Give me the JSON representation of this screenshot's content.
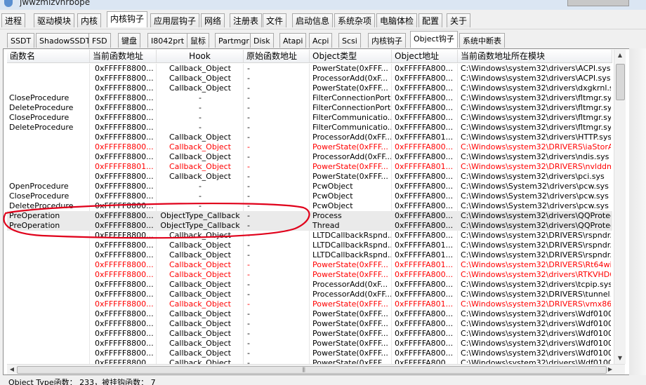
{
  "window": {
    "title": "jwwzmizvnrbope"
  },
  "menu_tabs": [
    "进程",
    "驱动模块",
    "内核",
    "内核钩子",
    "应用层钩子",
    "网络",
    "注册表",
    "文件",
    "启动信息",
    "系统杂项",
    "电脑体检",
    "配置",
    "关于"
  ],
  "sub_tabs": [
    "SSDT",
    "ShadowSSDT",
    "FSD",
    "键盘",
    "I8042prt",
    "鼠标",
    "Partmgr",
    "Disk",
    "Atapi",
    "Acpi",
    "Scsi",
    "内核钩子",
    "Object钩子",
    "系统中断表"
  ],
  "columns": [
    "函数名",
    "当前函数地址",
    "Hook",
    "原始函数地址",
    "Object类型",
    "Object地址",
    "当前函数地址所在模块"
  ],
  "rows": [
    {
      "name": "",
      "addr": "0xFFFFF8800...",
      "hook": "Callback_Object",
      "orig": "-",
      "type": "PowerState(0xFFF...",
      "oaddr": "0xFFFFFA800...",
      "module": "C:\\Windows\\system32\\drivers\\ACPI.sys",
      "red": false
    },
    {
      "name": "",
      "addr": "0xFFFFF8800...",
      "hook": "Callback_Object",
      "orig": "-",
      "type": "ProcessorAdd(0xF...",
      "oaddr": "0xFFFFFA800...",
      "module": "C:\\Windows\\system32\\drivers\\ACPI.sys",
      "red": false
    },
    {
      "name": "",
      "addr": "0xFFFFF8800...",
      "hook": "Callback_Object",
      "orig": "-",
      "type": "PowerState(0xFFF...",
      "oaddr": "0xFFFFFA800...",
      "module": "C:\\Windows\\system32\\drivers\\dxgkrnl.sys",
      "red": false
    },
    {
      "name": "CloseProcedure",
      "addr": "0xFFFFF8800...",
      "hook": "-",
      "orig": "-",
      "type": "FilterConnectionPort",
      "oaddr": "0xFFFFFA800...",
      "module": "C:\\Windows\\system32\\drivers\\fltmgr.sys",
      "red": false
    },
    {
      "name": "DeleteProcedure",
      "addr": "0xFFFFF8800...",
      "hook": "-",
      "orig": "-",
      "type": "FilterConnectionPort",
      "oaddr": "0xFFFFFA800...",
      "module": "C:\\Windows\\system32\\drivers\\fltmgr.sys",
      "red": false
    },
    {
      "name": "CloseProcedure",
      "addr": "0xFFFFF8800...",
      "hook": "-",
      "orig": "-",
      "type": "FilterCommunicatio...",
      "oaddr": "0xFFFFFA800...",
      "module": "C:\\Windows\\system32\\drivers\\fltmgr.sys",
      "red": false
    },
    {
      "name": "DeleteProcedure",
      "addr": "0xFFFFF8800...",
      "hook": "-",
      "orig": "-",
      "type": "FilterCommunicatio...",
      "oaddr": "0xFFFFFA800...",
      "module": "C:\\Windows\\system32\\drivers\\fltmgr.sys",
      "red": false
    },
    {
      "name": "",
      "addr": "0xFFFFF8800...",
      "hook": "Callback_Object",
      "orig": "-",
      "type": "ProcessorAdd(0xFF...",
      "oaddr": "0xFFFFFA801...",
      "module": "C:\\Windows\\system32\\drivers\\HTTP.sys",
      "red": false
    },
    {
      "name": "",
      "addr": "0xFFFFF8800...",
      "hook": "Callback_Object",
      "orig": "-",
      "type": "PowerState(0xFFF...",
      "oaddr": "0xFFFFFA800...",
      "module": "C:\\Windows\\system32\\DRIVERS\\iaStorA.sys",
      "red": true
    },
    {
      "name": "",
      "addr": "0xFFFFF8800...",
      "hook": "Callback_Object",
      "orig": "-",
      "type": "ProcessorAdd(0xFF...",
      "oaddr": "0xFFFFFA800...",
      "module": "C:\\Windows\\system32\\drivers\\ndis.sys",
      "red": false
    },
    {
      "name": "",
      "addr": "0xFFFFF8801...",
      "hook": "Callback_Object",
      "orig": "-",
      "type": "PowerState(0xFFF...",
      "oaddr": "0xFFFFFA801...",
      "module": "C:\\Windows\\system32\\DRIVERS\\nvlddmkm...",
      "red": true
    },
    {
      "name": "",
      "addr": "0xFFFFF8800...",
      "hook": "Callback_Object",
      "orig": "-",
      "type": "PowerState(0xFFF...",
      "oaddr": "0xFFFFFA800...",
      "module": "C:\\Windows\\system32\\drivers\\pci.sys",
      "red": false
    },
    {
      "name": "OpenProcedure",
      "addr": "0xFFFFF8800...",
      "hook": "-",
      "orig": "-",
      "type": "PcwObject",
      "oaddr": "0xFFFFFA800...",
      "module": "C:\\Windows\\System32\\drivers\\pcw.sys",
      "red": false
    },
    {
      "name": "CloseProcedure",
      "addr": "0xFFFFF8800...",
      "hook": "-",
      "orig": "-",
      "type": "PcwObject",
      "oaddr": "0xFFFFFA800...",
      "module": "C:\\Windows\\System32\\drivers\\pcw.sys",
      "red": false
    },
    {
      "name": "DeleteProcedure",
      "addr": "0xFFFFF8800...",
      "hook": "-",
      "orig": "-",
      "type": "PcwObject",
      "oaddr": "0xFFFFFA800...",
      "module": "C:\\Windows\\System32\\drivers\\pcw.sys",
      "red": false
    },
    {
      "name": "PreOperation",
      "addr": "0xFFFFF8800...",
      "hook": "ObjectType_Callback",
      "orig": "-",
      "type": "Process",
      "oaddr": "0xFFFFFA800...",
      "module": "C:\\Windows\\system32\\drivers\\QQProtectX6...",
      "red": false,
      "sel": true
    },
    {
      "name": "PreOperation",
      "addr": "0xFFFFF8800...",
      "hook": "ObjectType_Callback",
      "orig": "-",
      "type": "Thread",
      "oaddr": "0xFFFFFA800...",
      "module": "C:\\Windows\\system32\\drivers\\QQProtectX6...",
      "red": false,
      "sel": true
    },
    {
      "name": "",
      "addr": "0xFFFFF8800...",
      "hook": "Callback_Object",
      "orig": "-",
      "type": "LLTDCallbackRspnd...",
      "oaddr": "0xFFFFFA800...",
      "module": "C:\\Windows\\system32\\DRIVERS\\rspndr.sys",
      "red": false
    },
    {
      "name": "",
      "addr": "0xFFFFF8800...",
      "hook": "Callback_Object",
      "orig": "-",
      "type": "LLTDCallbackRspnd...",
      "oaddr": "0xFFFFFA801...",
      "module": "C:\\Windows\\system32\\DRIVERS\\rspndr.sys",
      "red": false
    },
    {
      "name": "",
      "addr": "0xFFFFF8800...",
      "hook": "Callback_Object",
      "orig": "-",
      "type": "LLTDCallbackRspnd...",
      "oaddr": "0xFFFFFA801...",
      "module": "C:\\Windows\\system32\\DRIVERS\\rspndr.sys",
      "red": false
    },
    {
      "name": "",
      "addr": "0xFFFFF8800...",
      "hook": "Callback_Object",
      "orig": "-",
      "type": "PowerState(0xFFF...",
      "oaddr": "0xFFFFFA801...",
      "module": "C:\\Windows\\system32\\DRIVERS\\Rt64win7.sys",
      "red": true
    },
    {
      "name": "",
      "addr": "0xFFFFF8800...",
      "hook": "Callback_Object",
      "orig": "-",
      "type": "PowerState(0xFFF...",
      "oaddr": "0xFFFFFA800...",
      "module": "C:\\Windows\\system32\\drivers\\RTKVHD64.sys",
      "red": true
    },
    {
      "name": "",
      "addr": "0xFFFFF8800...",
      "hook": "Callback_Object",
      "orig": "-",
      "type": "ProcessorAdd(0xF...",
      "oaddr": "0xFFFFFA800...",
      "module": "C:\\Windows\\system32\\drivers\\tcpip.sys",
      "red": false
    },
    {
      "name": "",
      "addr": "0xFFFFF8800...",
      "hook": "Callback_Object",
      "orig": "-",
      "type": "ProcessorAdd(0xFF...",
      "oaddr": "0xFFFFFA800...",
      "module": "C:\\Windows\\system32\\DRIVERS\\tunnel.sys",
      "red": false
    },
    {
      "name": "",
      "addr": "0xFFFFF8800...",
      "hook": "Callback_Object",
      "orig": "-",
      "type": "PowerState(0xFFF...",
      "oaddr": "0xFFFFFA801...",
      "module": "C:\\Windows\\system32\\DRIVERS\\vmx86.sys",
      "red": true
    },
    {
      "name": "",
      "addr": "0xFFFFF8800...",
      "hook": "Callback_Object",
      "orig": "-",
      "type": "PowerState(0xFFF...",
      "oaddr": "0xFFFFFA800...",
      "module": "C:\\Windows\\system32\\drivers\\Wdf01000.sys",
      "red": false
    },
    {
      "name": "",
      "addr": "0xFFFFF8800...",
      "hook": "Callback_Object",
      "orig": "-",
      "type": "PowerState(0xFFF...",
      "oaddr": "0xFFFFFA800...",
      "module": "C:\\Windows\\system32\\drivers\\Wdf01000.sys",
      "red": false
    },
    {
      "name": "",
      "addr": "0xFFFFF8800...",
      "hook": "Callback_Object",
      "orig": "-",
      "type": "PowerState(0xFFF...",
      "oaddr": "0xFFFFFA800...",
      "module": "C:\\Windows\\system32\\drivers\\Wdf01000.sys",
      "red": false
    },
    {
      "name": "",
      "addr": "0xFFFFF8800...",
      "hook": "Callback_Object",
      "orig": "-",
      "type": "PowerState(0xFFF...",
      "oaddr": "0xFFFFFA800...",
      "module": "C:\\Windows\\system32\\drivers\\Wdf01000.sys",
      "red": false
    },
    {
      "name": "",
      "addr": "0xFFFFF8800...",
      "hook": "Callback_Object",
      "orig": "-",
      "type": "PowerState(0xFFF...",
      "oaddr": "0xFFFFFA800...",
      "module": "C:\\Windows\\system32\\drivers\\Wdf01000.sys",
      "red": false
    },
    {
      "name": "",
      "addr": "0xFFFFF8800...",
      "hook": "Callback_Object",
      "orig": "-",
      "type": "PowerState(0xFFF...",
      "oaddr": "0xFFFFFA800...",
      "module": "C:\\Windows\\system32\\drivers\\Wdf01000.sys",
      "red": false
    }
  ],
  "status": {
    "text": "Object Type函数：  233，被挂钩函数：  7"
  },
  "colors": {
    "hooked_row": "#ff0000",
    "annotation": "#e0001a",
    "selected_row": "#eaeaea"
  },
  "icons": {
    "vscroll_up": "scroll-up-icon",
    "vscroll_down": "scroll-down-icon",
    "hscroll_left": "scroll-left-icon",
    "hscroll_right": "scroll-right-icon"
  }
}
